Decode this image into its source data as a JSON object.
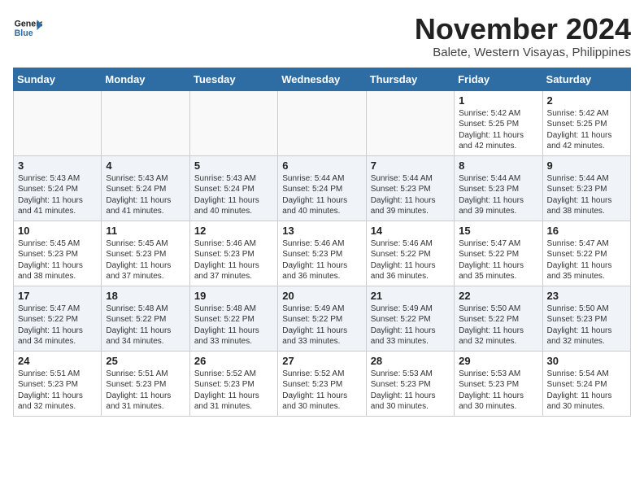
{
  "header": {
    "logo_line1": "General",
    "logo_line2": "Blue",
    "month": "November 2024",
    "location": "Balete, Western Visayas, Philippines"
  },
  "weekdays": [
    "Sunday",
    "Monday",
    "Tuesday",
    "Wednesday",
    "Thursday",
    "Friday",
    "Saturday"
  ],
  "weeks": [
    [
      {
        "day": "",
        "info": ""
      },
      {
        "day": "",
        "info": ""
      },
      {
        "day": "",
        "info": ""
      },
      {
        "day": "",
        "info": ""
      },
      {
        "day": "",
        "info": ""
      },
      {
        "day": "1",
        "info": "Sunrise: 5:42 AM\nSunset: 5:25 PM\nDaylight: 11 hours\nand 42 minutes."
      },
      {
        "day": "2",
        "info": "Sunrise: 5:42 AM\nSunset: 5:25 PM\nDaylight: 11 hours\nand 42 minutes."
      }
    ],
    [
      {
        "day": "3",
        "info": "Sunrise: 5:43 AM\nSunset: 5:24 PM\nDaylight: 11 hours\nand 41 minutes."
      },
      {
        "day": "4",
        "info": "Sunrise: 5:43 AM\nSunset: 5:24 PM\nDaylight: 11 hours\nand 41 minutes."
      },
      {
        "day": "5",
        "info": "Sunrise: 5:43 AM\nSunset: 5:24 PM\nDaylight: 11 hours\nand 40 minutes."
      },
      {
        "day": "6",
        "info": "Sunrise: 5:44 AM\nSunset: 5:24 PM\nDaylight: 11 hours\nand 40 minutes."
      },
      {
        "day": "7",
        "info": "Sunrise: 5:44 AM\nSunset: 5:23 PM\nDaylight: 11 hours\nand 39 minutes."
      },
      {
        "day": "8",
        "info": "Sunrise: 5:44 AM\nSunset: 5:23 PM\nDaylight: 11 hours\nand 39 minutes."
      },
      {
        "day": "9",
        "info": "Sunrise: 5:44 AM\nSunset: 5:23 PM\nDaylight: 11 hours\nand 38 minutes."
      }
    ],
    [
      {
        "day": "10",
        "info": "Sunrise: 5:45 AM\nSunset: 5:23 PM\nDaylight: 11 hours\nand 38 minutes."
      },
      {
        "day": "11",
        "info": "Sunrise: 5:45 AM\nSunset: 5:23 PM\nDaylight: 11 hours\nand 37 minutes."
      },
      {
        "day": "12",
        "info": "Sunrise: 5:46 AM\nSunset: 5:23 PM\nDaylight: 11 hours\nand 37 minutes."
      },
      {
        "day": "13",
        "info": "Sunrise: 5:46 AM\nSunset: 5:23 PM\nDaylight: 11 hours\nand 36 minutes."
      },
      {
        "day": "14",
        "info": "Sunrise: 5:46 AM\nSunset: 5:22 PM\nDaylight: 11 hours\nand 36 minutes."
      },
      {
        "day": "15",
        "info": "Sunrise: 5:47 AM\nSunset: 5:22 PM\nDaylight: 11 hours\nand 35 minutes."
      },
      {
        "day": "16",
        "info": "Sunrise: 5:47 AM\nSunset: 5:22 PM\nDaylight: 11 hours\nand 35 minutes."
      }
    ],
    [
      {
        "day": "17",
        "info": "Sunrise: 5:47 AM\nSunset: 5:22 PM\nDaylight: 11 hours\nand 34 minutes."
      },
      {
        "day": "18",
        "info": "Sunrise: 5:48 AM\nSunset: 5:22 PM\nDaylight: 11 hours\nand 34 minutes."
      },
      {
        "day": "19",
        "info": "Sunrise: 5:48 AM\nSunset: 5:22 PM\nDaylight: 11 hours\nand 33 minutes."
      },
      {
        "day": "20",
        "info": "Sunrise: 5:49 AM\nSunset: 5:22 PM\nDaylight: 11 hours\nand 33 minutes."
      },
      {
        "day": "21",
        "info": "Sunrise: 5:49 AM\nSunset: 5:22 PM\nDaylight: 11 hours\nand 33 minutes."
      },
      {
        "day": "22",
        "info": "Sunrise: 5:50 AM\nSunset: 5:22 PM\nDaylight: 11 hours\nand 32 minutes."
      },
      {
        "day": "23",
        "info": "Sunrise: 5:50 AM\nSunset: 5:23 PM\nDaylight: 11 hours\nand 32 minutes."
      }
    ],
    [
      {
        "day": "24",
        "info": "Sunrise: 5:51 AM\nSunset: 5:23 PM\nDaylight: 11 hours\nand 32 minutes."
      },
      {
        "day": "25",
        "info": "Sunrise: 5:51 AM\nSunset: 5:23 PM\nDaylight: 11 hours\nand 31 minutes."
      },
      {
        "day": "26",
        "info": "Sunrise: 5:52 AM\nSunset: 5:23 PM\nDaylight: 11 hours\nand 31 minutes."
      },
      {
        "day": "27",
        "info": "Sunrise: 5:52 AM\nSunset: 5:23 PM\nDaylight: 11 hours\nand 30 minutes."
      },
      {
        "day": "28",
        "info": "Sunrise: 5:53 AM\nSunset: 5:23 PM\nDaylight: 11 hours\nand 30 minutes."
      },
      {
        "day": "29",
        "info": "Sunrise: 5:53 AM\nSunset: 5:23 PM\nDaylight: 11 hours\nand 30 minutes."
      },
      {
        "day": "30",
        "info": "Sunrise: 5:54 AM\nSunset: 5:24 PM\nDaylight: 11 hours\nand 30 minutes."
      }
    ]
  ]
}
